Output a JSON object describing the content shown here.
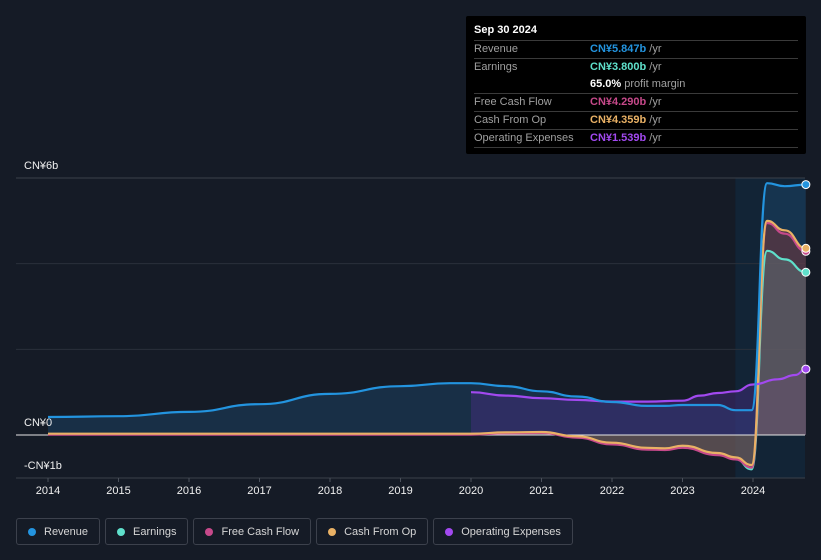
{
  "colors": {
    "revenue": "#2394df",
    "earnings": "#5fe0cb",
    "free_cash_flow": "#c6498a",
    "cash_from_op": "#e9b165",
    "operating_expenses": "#a249f0",
    "background": "#151b26",
    "grid": "#2a303b",
    "zero_line": "#e6e6e6"
  },
  "tooltip": {
    "date": "Sep 30 2024",
    "rows": [
      {
        "label": "Revenue",
        "value": "CN¥5.847b",
        "unit": "/yr",
        "color": "#2394df"
      },
      {
        "label": "Earnings",
        "value": "CN¥3.800b",
        "unit": "/yr",
        "color": "#5fe0cb"
      },
      {
        "label": "",
        "value": "65.0%",
        "unit": "profit margin",
        "color": "#ffffff"
      },
      {
        "label": "Free Cash Flow",
        "value": "CN¥4.290b",
        "unit": "/yr",
        "color": "#c6498a"
      },
      {
        "label": "Cash From Op",
        "value": "CN¥4.359b",
        "unit": "/yr",
        "color": "#e9b165"
      },
      {
        "label": "Operating Expenses",
        "value": "CN¥1.539b",
        "unit": "/yr",
        "color": "#a249f0"
      }
    ]
  },
  "legend": [
    {
      "label": "Revenue",
      "color": "#2394df"
    },
    {
      "label": "Earnings",
      "color": "#5fe0cb"
    },
    {
      "label": "Free Cash Flow",
      "color": "#c6498a"
    },
    {
      "label": "Cash From Op",
      "color": "#e9b165"
    },
    {
      "label": "Operating Expenses",
      "color": "#a249f0"
    }
  ],
  "chart_data": {
    "type": "area",
    "title": "",
    "xlabel": "",
    "ylabel": "",
    "currency": "CN¥",
    "unit": "billions",
    "xlim": [
      2014,
      2024.75
    ],
    "ylim": [
      -1,
      6
    ],
    "y_ticks": [
      {
        "value": 6,
        "label": "CN¥6b"
      },
      {
        "value": 0,
        "label": "CN¥0"
      },
      {
        "value": -1,
        "label": "-CN¥1b"
      }
    ],
    "x_ticks": [
      "2014",
      "2015",
      "2016",
      "2017",
      "2018",
      "2019",
      "2020",
      "2021",
      "2022",
      "2023",
      "2024"
    ],
    "grid": true,
    "highlight_range": [
      2023.75,
      2024.75
    ],
    "legend_position": "bottom",
    "series": [
      {
        "name": "Revenue",
        "key": "revenue",
        "points": [
          [
            2014,
            0.42
          ],
          [
            2015,
            0.44
          ],
          [
            2016,
            0.54
          ],
          [
            2017,
            0.72
          ],
          [
            2018,
            0.96
          ],
          [
            2019,
            1.14
          ],
          [
            2019.7,
            1.21
          ],
          [
            2020,
            1.21
          ],
          [
            2020.5,
            1.14
          ],
          [
            2021,
            1.02
          ],
          [
            2021.5,
            0.9
          ],
          [
            2022,
            0.77
          ],
          [
            2022.5,
            0.68
          ],
          [
            2022.75,
            0.68
          ],
          [
            2023,
            0.7
          ],
          [
            2023.5,
            0.7
          ],
          [
            2023.75,
            0.58
          ],
          [
            2023.98,
            0.58
          ],
          [
            2024.2,
            5.88
          ],
          [
            2024.45,
            5.81
          ],
          [
            2024.75,
            5.847
          ]
        ]
      },
      {
        "name": "Earnings",
        "key": "earnings",
        "points": [
          [
            2014,
            0.02
          ],
          [
            2015,
            0.02
          ],
          [
            2016,
            0.02
          ],
          [
            2017,
            0.02
          ],
          [
            2018,
            0.02
          ],
          [
            2019,
            0.02
          ],
          [
            2020,
            0.02
          ],
          [
            2020.5,
            0.05
          ],
          [
            2021,
            0.06
          ],
          [
            2021.5,
            -0.05
          ],
          [
            2022,
            -0.2
          ],
          [
            2022.5,
            -0.32
          ],
          [
            2022.75,
            -0.33
          ],
          [
            2023,
            -0.28
          ],
          [
            2023.5,
            -0.45
          ],
          [
            2023.75,
            -0.55
          ],
          [
            2023.98,
            -0.8
          ],
          [
            2024.2,
            4.3
          ],
          [
            2024.45,
            4.1
          ],
          [
            2024.75,
            3.8
          ]
        ]
      },
      {
        "name": "Free Cash Flow",
        "key": "free_cash_flow",
        "points": [
          [
            2014,
            0.01
          ],
          [
            2015,
            0.01
          ],
          [
            2016,
            0.01
          ],
          [
            2017,
            0.01
          ],
          [
            2018,
            0.01
          ],
          [
            2019,
            0.01
          ],
          [
            2020,
            0.01
          ],
          [
            2020.5,
            0.04
          ],
          [
            2021,
            0.05
          ],
          [
            2021.5,
            -0.06
          ],
          [
            2022,
            -0.22
          ],
          [
            2022.5,
            -0.34
          ],
          [
            2022.75,
            -0.35
          ],
          [
            2023,
            -0.3
          ],
          [
            2023.5,
            -0.47
          ],
          [
            2023.75,
            -0.57
          ],
          [
            2023.98,
            -0.76
          ],
          [
            2024.2,
            4.95
          ],
          [
            2024.45,
            4.7
          ],
          [
            2024.75,
            4.29
          ]
        ]
      },
      {
        "name": "Cash From Op",
        "key": "cash_from_op",
        "points": [
          [
            2014,
            0.03
          ],
          [
            2015,
            0.03
          ],
          [
            2016,
            0.03
          ],
          [
            2017,
            0.03
          ],
          [
            2018,
            0.03
          ],
          [
            2019,
            0.03
          ],
          [
            2020,
            0.03
          ],
          [
            2020.5,
            0.06
          ],
          [
            2021,
            0.07
          ],
          [
            2021.5,
            -0.03
          ],
          [
            2022,
            -0.18
          ],
          [
            2022.5,
            -0.3
          ],
          [
            2022.75,
            -0.31
          ],
          [
            2023,
            -0.25
          ],
          [
            2023.5,
            -0.42
          ],
          [
            2023.75,
            -0.52
          ],
          [
            2023.98,
            -0.7
          ],
          [
            2024.2,
            5.0
          ],
          [
            2024.45,
            4.78
          ],
          [
            2024.75,
            4.359
          ]
        ]
      },
      {
        "name": "Operating Expenses",
        "key": "operating_expenses",
        "points": [
          [
            2020,
            1.0
          ],
          [
            2020.5,
            0.92
          ],
          [
            2021,
            0.86
          ],
          [
            2021.5,
            0.82
          ],
          [
            2022,
            0.78
          ],
          [
            2022.5,
            0.78
          ],
          [
            2023,
            0.8
          ],
          [
            2023.25,
            0.92
          ],
          [
            2023.5,
            0.98
          ],
          [
            2023.75,
            1.02
          ],
          [
            2024,
            1.18
          ],
          [
            2024.35,
            1.3
          ],
          [
            2024.6,
            1.4
          ],
          [
            2024.75,
            1.539
          ]
        ]
      }
    ]
  }
}
